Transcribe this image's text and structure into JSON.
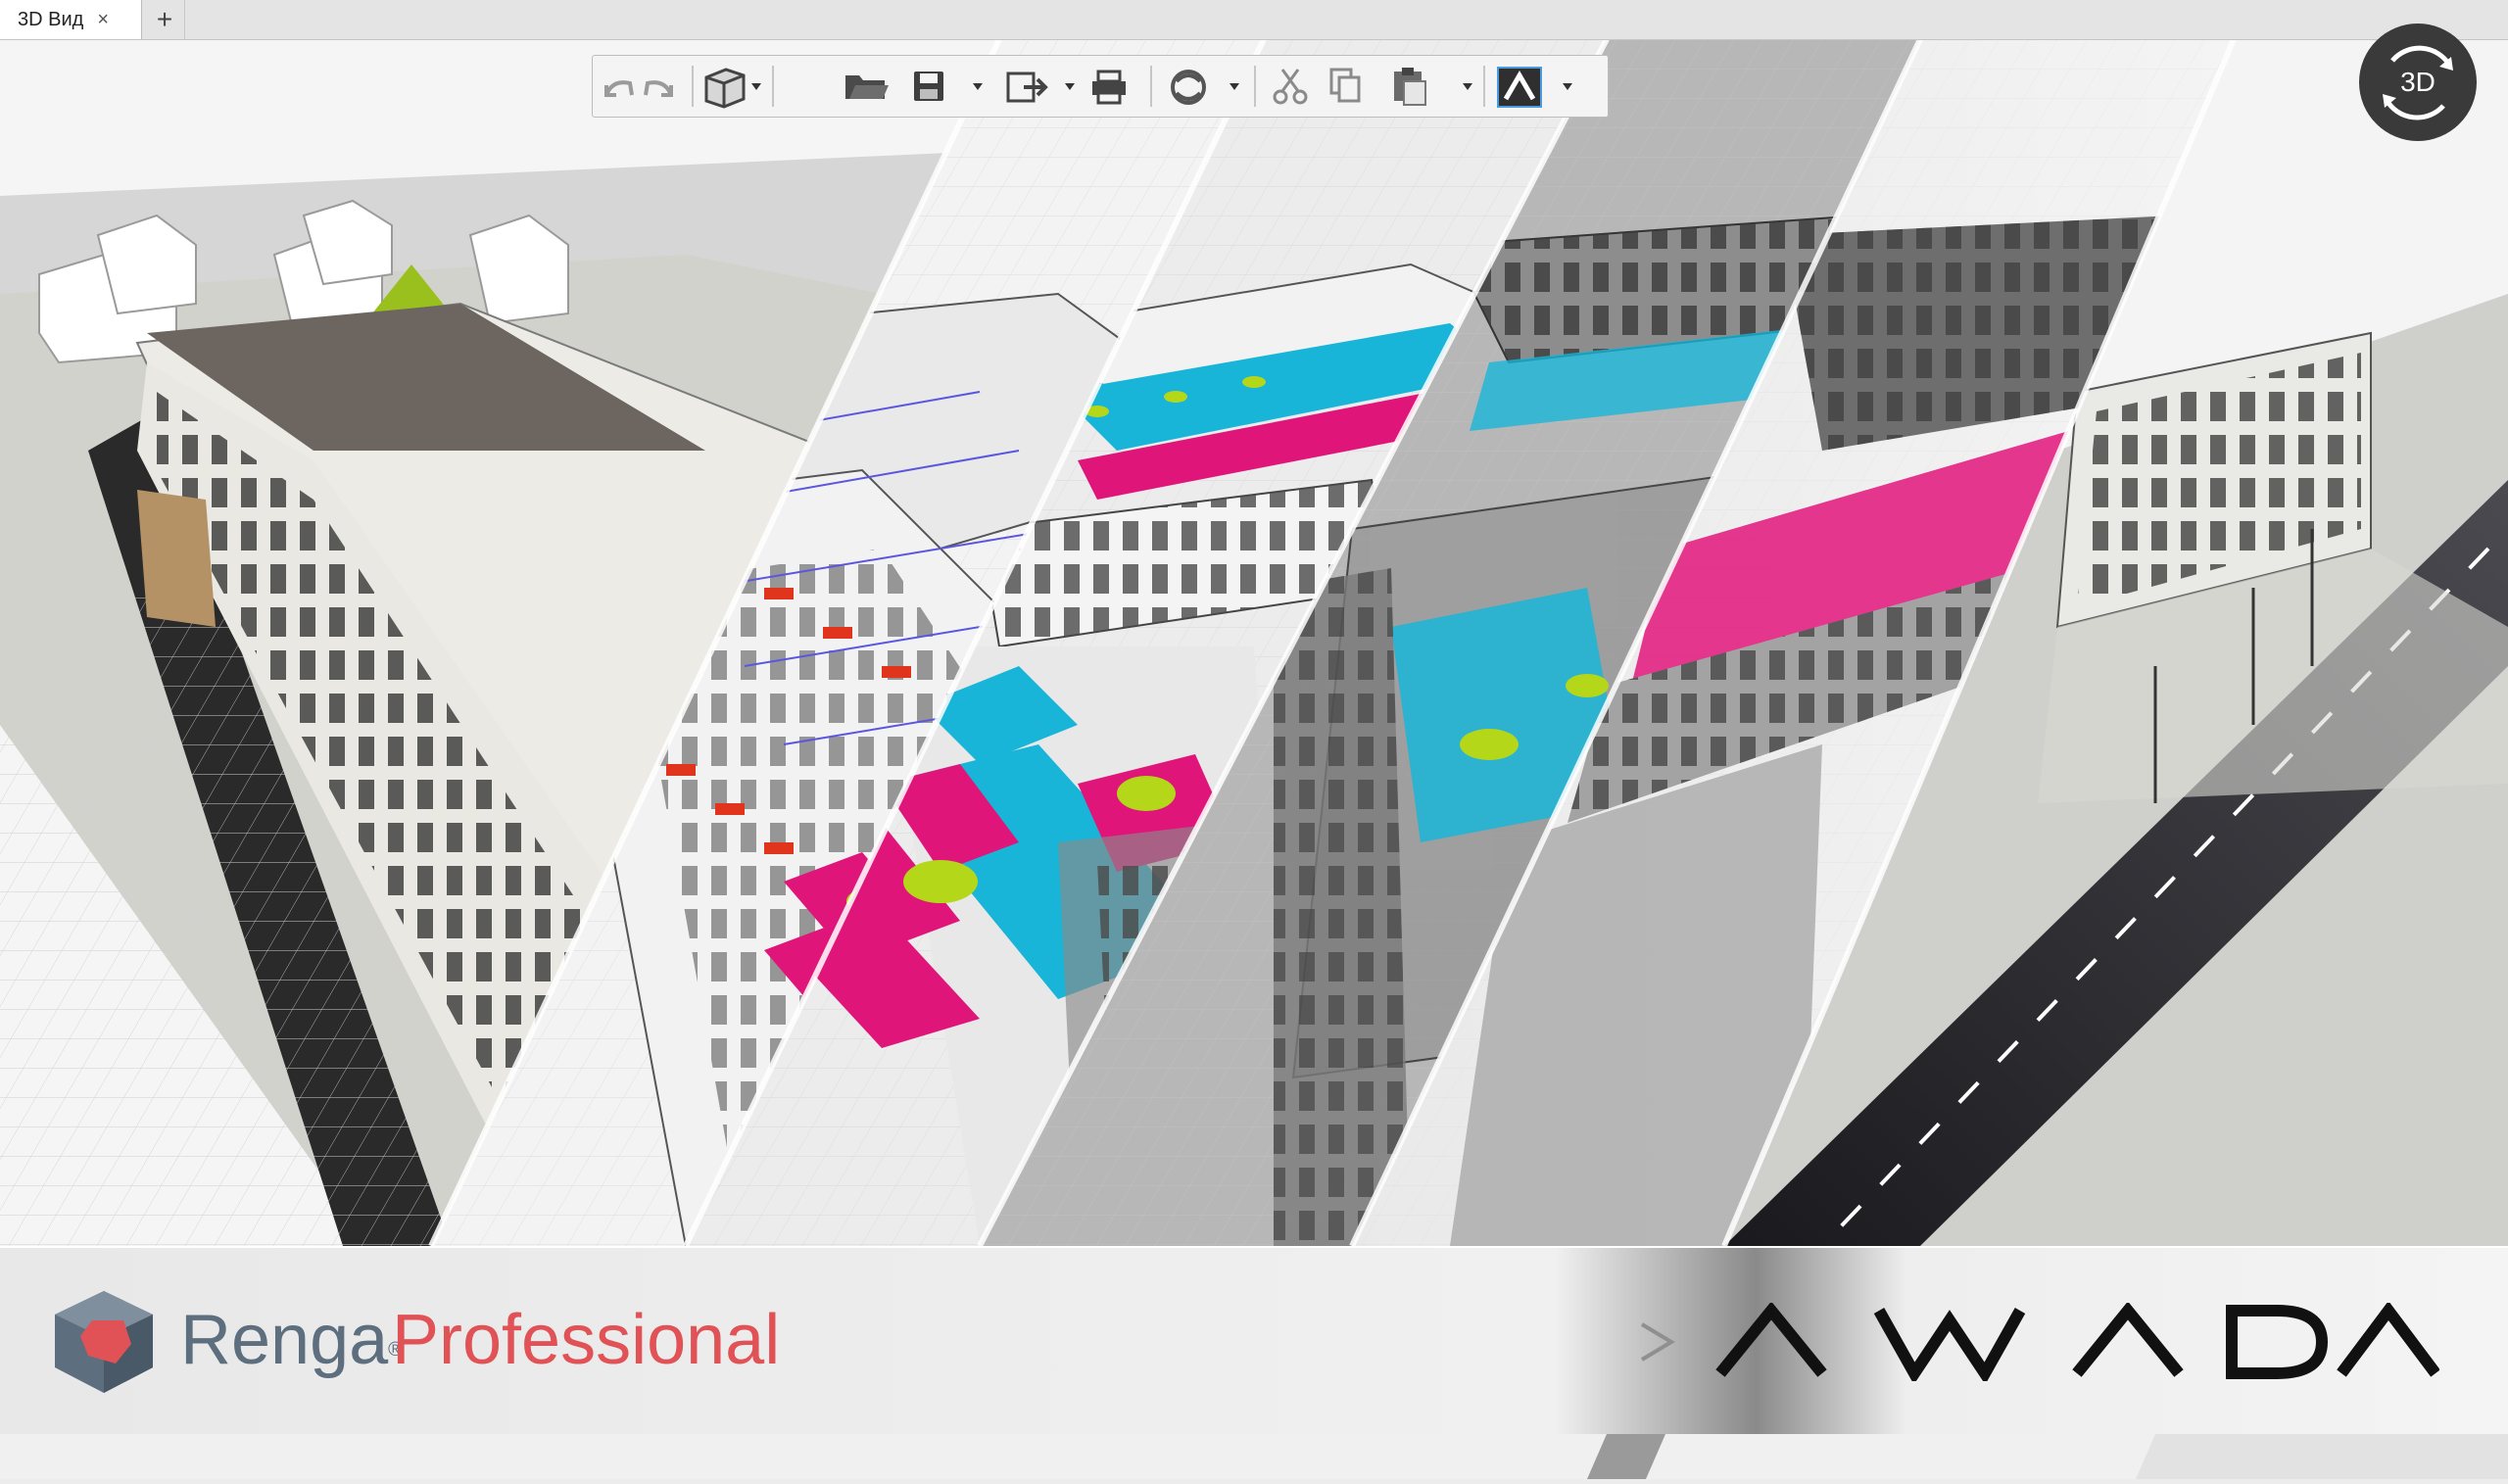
{
  "tabs": [
    {
      "label": "3D Вид",
      "close": "×"
    }
  ],
  "add_tab": "+",
  "toolbar": {
    "buttons": [
      {
        "icon": "undo-icon"
      },
      {
        "icon": "redo-icon"
      },
      {
        "icon": "view-cube-icon"
      },
      {
        "icon": "open-folder-icon"
      },
      {
        "icon": "save-icon"
      },
      {
        "icon": "export-icon"
      },
      {
        "icon": "print-icon"
      },
      {
        "icon": "sync-icon"
      },
      {
        "icon": "cut-icon"
      },
      {
        "icon": "copy-icon"
      },
      {
        "icon": "paste-icon"
      },
      {
        "icon": "app-logo-icon"
      }
    ]
  },
  "view3d": {
    "label": "3D"
  },
  "banner": {
    "product_brand": "Renga",
    "product_reg": "®",
    "product_edition": "Professional",
    "target_brand": "AWADA"
  },
  "colors": {
    "accent_red": "#e05256",
    "brand_gray": "#5d6e7e",
    "cyan": "#19b5d8",
    "magenta": "#e0157a",
    "lime": "#b4d71a"
  }
}
